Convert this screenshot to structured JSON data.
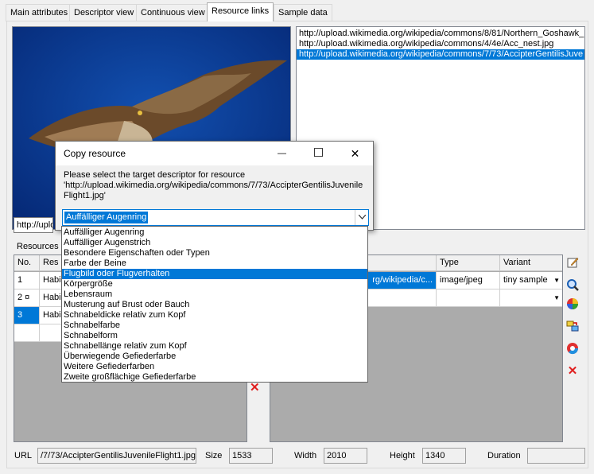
{
  "tabs": [
    "Main attributes",
    "Descriptor view",
    "Continuous view",
    "Resource links",
    "Sample data"
  ],
  "active_tab": "Resource links",
  "url_list": [
    "http://upload.wikimedia.org/wikipedia/commons/8/81/Northern_Goshawk_",
    "http://upload.wikimedia.org/wikipedia/commons/4/4e/Acc_nest.jpg",
    "http://upload.wikimedia.org/wikipedia/commons/7/73/AccipterGentilisJuve"
  ],
  "url_field_value": "http://uplo",
  "resources_label": "Resources",
  "left_grid": {
    "headers": [
      "No.",
      "Res"
    ],
    "rows": [
      {
        "no": "1",
        "res": "Habi"
      },
      {
        "no": "2 ¤",
        "res": "Habi"
      },
      {
        "no": "3",
        "res": "Habi"
      }
    ]
  },
  "right_grid": {
    "headers": [
      "",
      "Type",
      "Variant"
    ],
    "row": {
      "url": "rg/wikipedia/c...",
      "type": "image/jpeg",
      "variant": "tiny sample"
    }
  },
  "dialog": {
    "title": "Copy resource",
    "message_line1": "Please select the target descriptor for resource",
    "message_line2": "'http://upload.wikimedia.org/wikipedia/commons/7/73/AccipterGentilisJuvenile",
    "message_line3": "Flight1.jpg'",
    "selected": "Auffälliger Augenring",
    "minimize": "—",
    "maximize": "☐",
    "close": "✕"
  },
  "dropdown_items": [
    "Auffälliger Augenring",
    "Auffälliger Augenstrich",
    "Besondere Eigenschaften oder Typen",
    "Farbe der Beine",
    "Flugbild oder Flugverhalten",
    "Körpergröße",
    "Lebensraum",
    "Musterung auf Brust oder Bauch",
    "Schnabeldicke relativ zum Kopf",
    "Schnabelfarbe",
    "Schnabelform",
    "Schnabellänge relativ zum Kopf",
    "Überwiegende Gefiederfarbe",
    "Weitere Gefiederfarben",
    "Zweite großflächige Gefiederfarbe"
  ],
  "dropdown_selected_index": 4,
  "status": {
    "url_label": "URL",
    "url_value": "/7/73/AccipterGentilisJuvenileFlight1.jpg",
    "size_label": "Size",
    "size_value": "1533",
    "width_label": "Width",
    "width_value": "2010",
    "height_label": "Height",
    "height_value": "1340",
    "duration_label": "Duration",
    "duration_value": ""
  },
  "colors": {
    "accent": "#0078d7",
    "sky": "#0a3a93"
  }
}
